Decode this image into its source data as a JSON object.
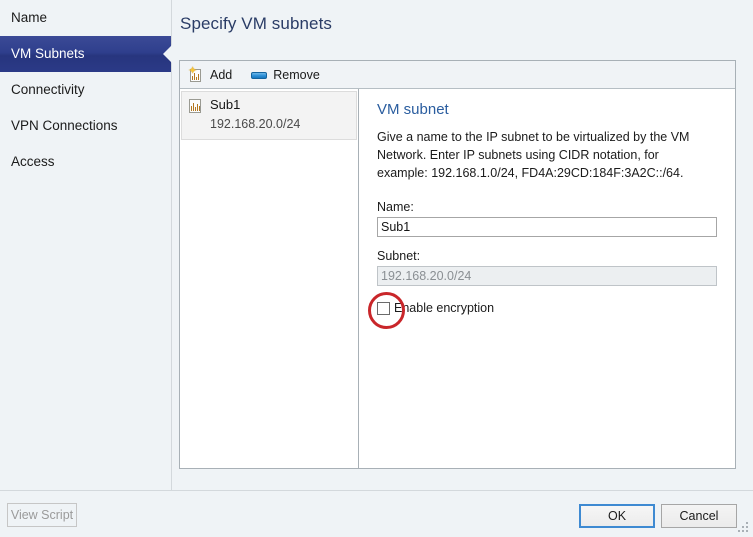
{
  "dialog": {
    "page_title": "Specify VM subnets"
  },
  "sidebar": {
    "items": [
      {
        "label": "Name",
        "selected": false
      },
      {
        "label": "VM Subnets",
        "selected": true
      },
      {
        "label": "Connectivity",
        "selected": false
      },
      {
        "label": "VPN Connections",
        "selected": false
      },
      {
        "label": "Access",
        "selected": false
      }
    ]
  },
  "toolbar": {
    "add_label": "Add",
    "add_icon": "add-subnet-icon",
    "remove_label": "Remove",
    "remove_icon": "remove-icon"
  },
  "list": {
    "items": [
      {
        "name": "Sub1",
        "subnet": "192.168.20.0/24",
        "icon": "subnet-icon",
        "selected": true
      }
    ]
  },
  "detail": {
    "title": "VM subnet",
    "description": "Give a name to the IP subnet to be virtualized by the VM Network. Enter IP subnets using CIDR notation, for example: 192.168.1.0/24, FD4A:29CD:184F:3A2C::/64.",
    "name_label": "Name:",
    "name_value": "Sub1",
    "subnet_label": "Subnet:",
    "subnet_value": "192.168.20.0/24",
    "subnet_disabled": true,
    "encryption_label": "Enable encryption",
    "encryption_checked": false
  },
  "annotation": {
    "shape": "red-circle-highlight",
    "color": "#c9262a",
    "target": "enable-encryption-checkbox"
  },
  "footer": {
    "view_script_label": "View Script",
    "view_script_disabled": true,
    "ok_label": "OK",
    "cancel_label": "Cancel"
  },
  "colors": {
    "selection_blue": "#2f3f8d",
    "title_blue": "#2a3c66",
    "heading_blue": "#2a5d9f",
    "focus_blue": "#3e8ad2",
    "annotation_red": "#c9262a",
    "window_background": "#eff3f6"
  }
}
